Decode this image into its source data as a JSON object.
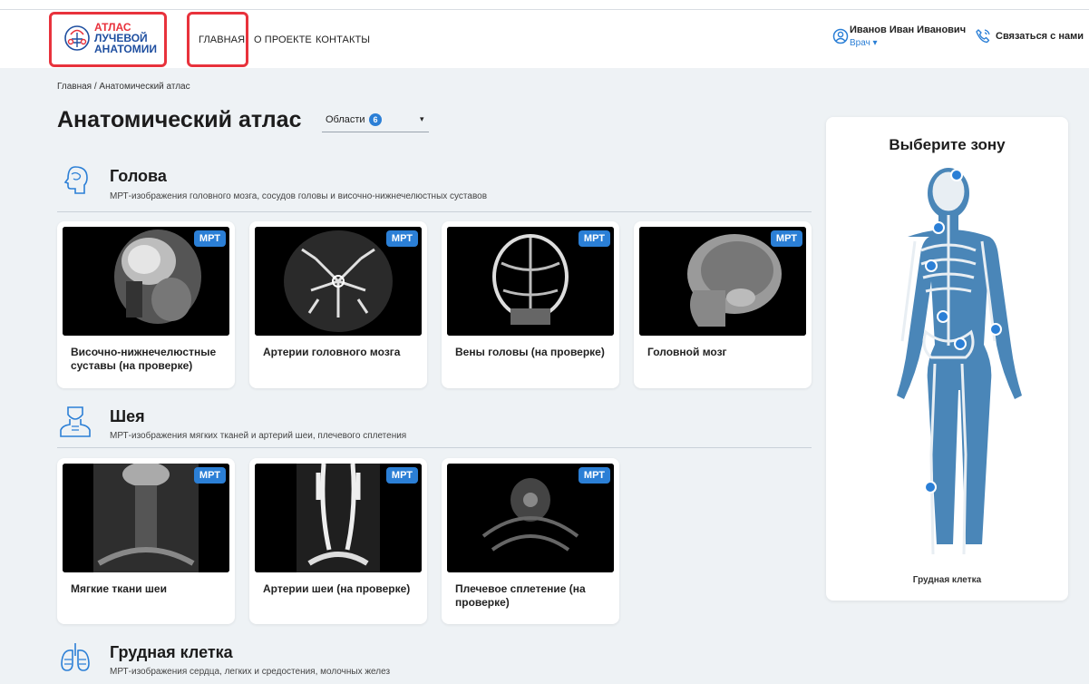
{
  "header": {
    "logo": {
      "line1": "АТЛАС",
      "line2": "ЛУЧЕВОЙ",
      "line3": "АНАТОМИИ"
    },
    "nav": [
      {
        "label": "ГЛАВНАЯ",
        "active": true
      },
      {
        "label": "О ПРОЕКТЕ",
        "active": false
      },
      {
        "label": "КОНТАКТЫ",
        "active": false
      }
    ],
    "user": {
      "name": "Иванов Иван Иванович",
      "role": "Врач ▾"
    },
    "contact_label": "Связаться с нами",
    "accent": "#2b7fd6",
    "highlight": "#e8323c"
  },
  "breadcrumb": "Главная  /  Анатомический атлас",
  "page_title": "Анатомический атлас",
  "regions_filter": {
    "label": "Области",
    "count": "6",
    "caret": "▾"
  },
  "sections": [
    {
      "title": "Голова",
      "icon": "head-icon",
      "description": "МРТ-изображения головного мозга, сосудов головы и височно-нижнечелюстных суставов",
      "cards": [
        {
          "badge": "МРТ",
          "title": "Височно-нижнечелюстные суставы (на проверке)"
        },
        {
          "badge": "МРТ",
          "title": "Артерии головного мозга"
        },
        {
          "badge": "МРТ",
          "title": "Вены головы (на проверке)"
        },
        {
          "badge": "МРТ",
          "title": "Головной мозг"
        }
      ]
    },
    {
      "title": "Шея",
      "icon": "neck-icon",
      "description": "МРТ-изображения мягких тканей и артерий шеи, плечевого сплетения",
      "cards": [
        {
          "badge": "МРТ",
          "title": "Мягкие ткани шеи"
        },
        {
          "badge": "МРТ",
          "title": "Артерии шеи (на проверке)"
        },
        {
          "badge": "МРТ",
          "title": "Плечевое сплетение (на проверке)"
        }
      ]
    },
    {
      "title": "Грудная клетка",
      "icon": "lungs-icon",
      "description": "МРТ-изображения сердца, легких и средостения, молочных желез",
      "cards": []
    }
  ],
  "zone_panel": {
    "title": "Выберите зону",
    "selected_zone": "Грудная клетка"
  }
}
